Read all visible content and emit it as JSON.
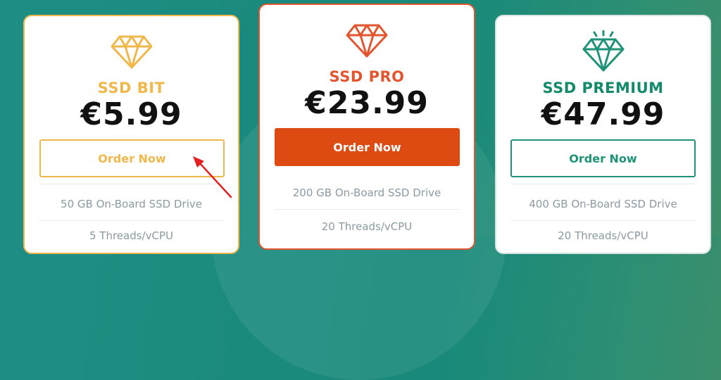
{
  "colors": {
    "bit_accent": "#f0b84a",
    "pro_accent": "#e2552e",
    "pro_button": "#dd4a12",
    "premium_accent": "#1f9378",
    "premium_text": "#138a6a",
    "feature_text": "#8a9aa3"
  },
  "plans": [
    {
      "name": "SSD BIT",
      "price": "€5.99",
      "button": "Order Now",
      "icon": "diamond-icon",
      "features": [
        "50 GB On-Board SSD Drive",
        "5 Threads/vCPU"
      ]
    },
    {
      "name": "SSD PRO",
      "price": "€23.99",
      "button": "Order Now",
      "icon": "diamond-icon",
      "features": [
        "200 GB On-Board SSD Drive",
        "20 Threads/vCPU"
      ]
    },
    {
      "name": "SSD PREMIUM",
      "price": "€47.99",
      "button": "Order Now",
      "icon": "sparkling-diamond-icon",
      "features": [
        "400 GB On-Board SSD Drive",
        "20 Threads/vCPU"
      ]
    }
  ]
}
